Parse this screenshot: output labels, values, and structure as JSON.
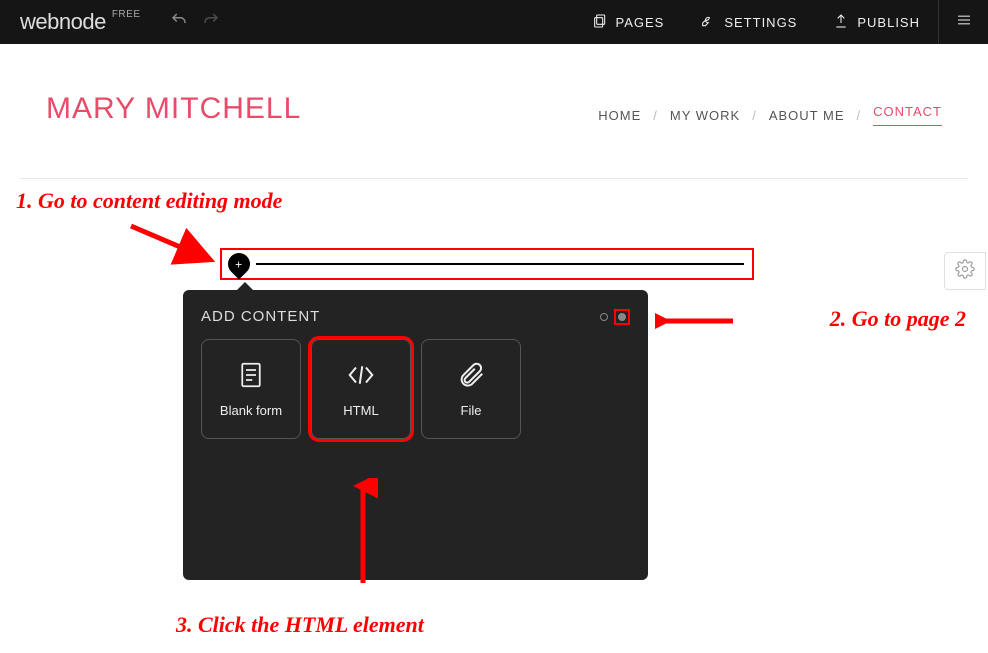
{
  "topbar": {
    "brand_prefix": "web",
    "brand_suffix": "node",
    "free_badge": "FREE",
    "pages_label": "PAGES",
    "settings_label": "SETTINGS",
    "publish_label": "PUBLISH"
  },
  "site": {
    "title": "MARY MITCHELL",
    "nav": {
      "home": "HOME",
      "work": "MY WORK",
      "about": "ABOUT ME",
      "contact": "CONTACT"
    }
  },
  "panel": {
    "title": "ADD CONTENT",
    "options": {
      "blank_form": "Blank form",
      "html": "HTML",
      "file": "File"
    }
  },
  "annotations": {
    "step1": "1. Go to content editing mode",
    "step2": "2. Go to page 2",
    "step3": "3. Click the HTML element"
  },
  "colors": {
    "accent": "#e94b6a",
    "annotation": "#ff0000",
    "panel_bg": "#232323",
    "topbar_bg": "#151515"
  }
}
